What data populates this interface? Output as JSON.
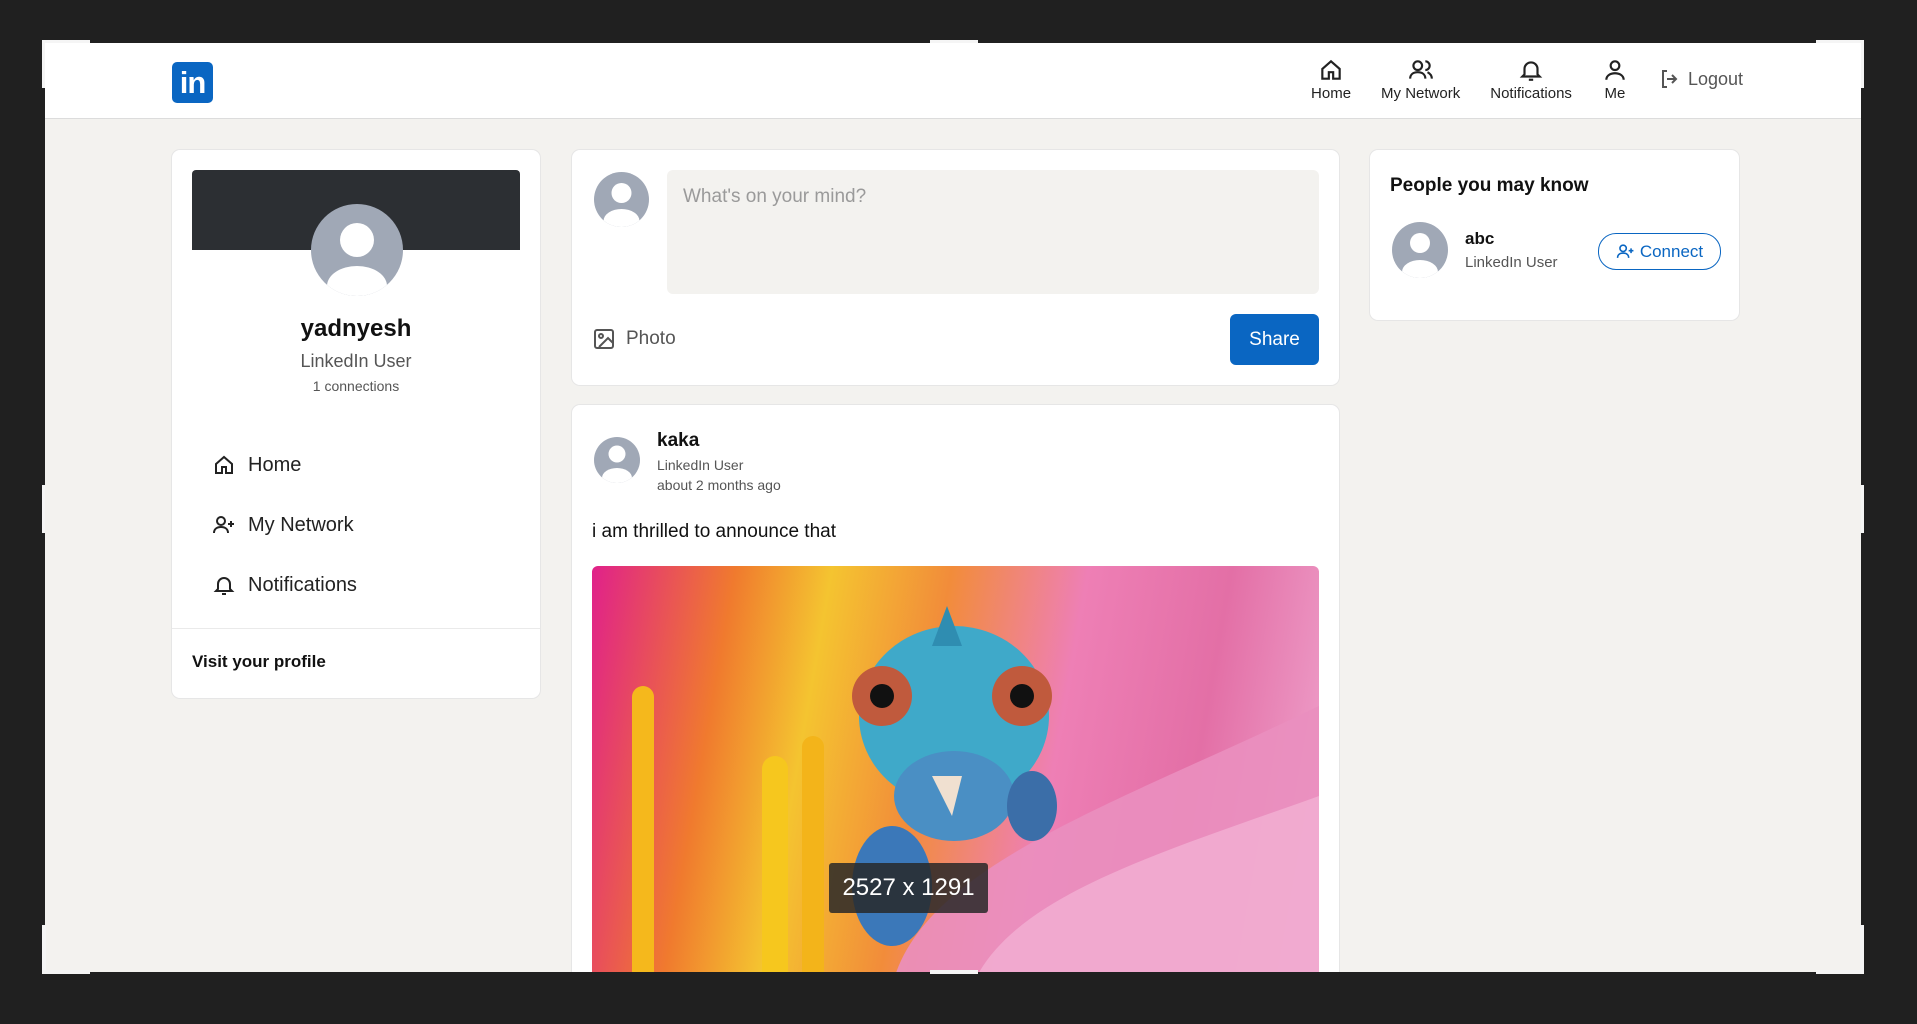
{
  "navbar": {
    "logo_text": "in",
    "items": [
      {
        "label": "Home",
        "icon": "home-icon"
      },
      {
        "label": "My Network",
        "icon": "network-icon"
      },
      {
        "label": "Notifications",
        "icon": "bell-icon"
      },
      {
        "label": "Me",
        "icon": "user-icon"
      }
    ],
    "logout_label": "Logout"
  },
  "profile": {
    "name": "yadnyesh",
    "headline": "LinkedIn User",
    "connections": "1 connections",
    "menu": [
      {
        "label": "Home",
        "icon": "home-icon"
      },
      {
        "label": "My Network",
        "icon": "add-user-icon"
      },
      {
        "label": "Notifications",
        "icon": "bell-icon"
      }
    ],
    "visit_label": "Visit your profile"
  },
  "composer": {
    "placeholder": "What's on your mind?",
    "photo_label": "Photo",
    "share_label": "Share"
  },
  "post": {
    "author": "kaka",
    "role": "LinkedIn User",
    "time": "about 2 months ago",
    "text": "i am thrilled to announce that"
  },
  "overlay": {
    "size_label": "2527 x 1291"
  },
  "people": {
    "title": "People you may know",
    "items": [
      {
        "name": "abc",
        "role": "LinkedIn User",
        "action": "Connect"
      }
    ]
  },
  "colors": {
    "brand": "#0a66c2",
    "page_bg": "#f3f2ef",
    "avatar": "#a0a8b6"
  }
}
